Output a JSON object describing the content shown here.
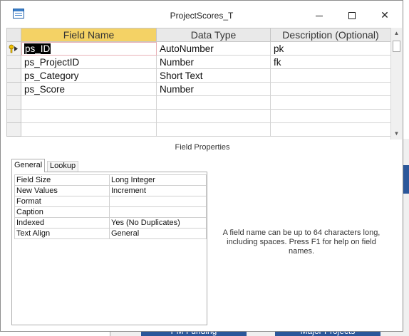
{
  "window": {
    "title": "ProjectScores_T",
    "icon": "table-icon"
  },
  "design_grid": {
    "columns": [
      "Field Name",
      "Data Type",
      "Description (Optional)"
    ],
    "rows": [
      {
        "field_name": "ps_ID",
        "data_type": "AutoNumber",
        "description": "pk",
        "primary_key": true
      },
      {
        "field_name": "ps_ProjectID",
        "data_type": "Number",
        "description": "fk"
      },
      {
        "field_name": "ps_Category",
        "data_type": "Short Text",
        "description": ""
      },
      {
        "field_name": "ps_Score",
        "data_type": "Number",
        "description": ""
      },
      {
        "field_name": "",
        "data_type": "",
        "description": ""
      },
      {
        "field_name": "",
        "data_type": "",
        "description": ""
      },
      {
        "field_name": "",
        "data_type": "",
        "description": ""
      }
    ]
  },
  "field_properties": {
    "label": "Field Properties",
    "tabs": [
      "General",
      "Lookup"
    ],
    "active_tab": "General",
    "general": [
      {
        "property": "Field Size",
        "value": "Long Integer"
      },
      {
        "property": "New Values",
        "value": "Increment"
      },
      {
        "property": "Format",
        "value": ""
      },
      {
        "property": "Caption",
        "value": ""
      },
      {
        "property": "Indexed",
        "value": "Yes (No Duplicates)"
      },
      {
        "property": "Text Align",
        "value": "General"
      }
    ],
    "help_text": "A field name can be up to 64 characters long, including spaces. Press F1 for help on field names."
  },
  "background_app": {
    "buttons": [
      "PM Funding",
      "Major Projects"
    ]
  },
  "colors": {
    "header_selected": "#f4d265",
    "background_accent": "#2b579a"
  }
}
